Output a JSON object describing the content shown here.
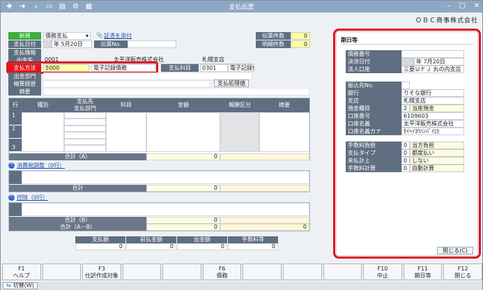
{
  "window": {
    "title": "支払伝票",
    "company": "ＯＢＣ商事株式会社"
  },
  "header": {
    "new_label": "新規",
    "slip_type": "債務支払",
    "evidence_link": "証憑を添付",
    "pay_date_label": "支払日付",
    "pay_date_value": "年  5月20日",
    "slip_no_label": "伝票No.",
    "pay_info_label": "支払情報",
    "payee_label": "出金先",
    "payee_code": "0001",
    "payee_name": "太平洋販売株式会社",
    "branch": "札幌支店",
    "method_label": "支払方法",
    "method_code": "5000",
    "method_name": "電子記録債務",
    "account_label": "支払科目",
    "account_code": "0301",
    "account_name": "電子記録債",
    "dept_label": "出金部門",
    "approval_label": "精算経歴",
    "process_button": "支払処理値",
    "memo_label": "摘要",
    "slip_count_label": "伝票件数",
    "slip_count_value": "0",
    "detail_count_label": "明細件数",
    "detail_count_value": "0"
  },
  "grid": {
    "headers": [
      "行",
      "種別",
      "支払先",
      "支払部門",
      "科目",
      "金額",
      "報酬区分",
      "摘要"
    ],
    "rows": [
      "1",
      "2",
      "3"
    ],
    "total_a_label": "合計（A）",
    "total_a_value": "0"
  },
  "tax_section": {
    "label": "消費税調整（0行）",
    "total_label": "合計",
    "total_value": "0"
  },
  "deduction_section": {
    "label": "控除（0行）",
    "total_b_label": "合計（B）",
    "total_b_value": "0",
    "total_ab_label": "合計（A－B）",
    "total_ab_value1": "0",
    "total_ab_value2": "0"
  },
  "summary": {
    "headers": [
      "支払額",
      "前払金額",
      "出金額",
      "手数料等"
    ],
    "values": [
      "0",
      "0",
      "0",
      "0"
    ]
  },
  "panel": {
    "title": "期日等",
    "rows1": [
      {
        "label": "債務番号",
        "value": ""
      },
      {
        "label": "決済日付",
        "value": "年  7月20日"
      },
      {
        "label": "法人口座",
        "value": "三菱ＵＦＪ  丸の内支店"
      }
    ],
    "rows2": [
      {
        "label": "振込先No.",
        "value": ""
      },
      {
        "label": "銀行",
        "value": "りそな銀行"
      },
      {
        "label": "支店",
        "value": "札幌支店"
      },
      {
        "label": "預金種目",
        "code": "2",
        "value": "当座預金"
      },
      {
        "label": "口座番号",
        "value": "6109603"
      },
      {
        "label": "口座名義",
        "value": "太平洋販売株式会社"
      },
      {
        "label": "口座名義カナ",
        "value": "ﾀｲﾍｲﾖｳﾊﾝﾊﾞｲ(ｶ"
      }
    ],
    "rows3": [
      {
        "label": "手数料負担",
        "code": "0",
        "value": "当方負担"
      },
      {
        "label": "支払タイプ",
        "code": "0",
        "value": "都度払い"
      },
      {
        "label": "未払計上",
        "code": "0",
        "value": "しない"
      },
      {
        "label": "手数料計算",
        "code": "0",
        "value": "自動計算"
      }
    ],
    "close_button": "閉じる(C)"
  },
  "fkeys": [
    {
      "key": "F1",
      "label": "ヘルプ"
    },
    {
      "key": "",
      "label": ""
    },
    {
      "key": "F3",
      "label": "仕訳作成対象"
    },
    {
      "key": "",
      "label": ""
    },
    {
      "key": "",
      "label": ""
    },
    {
      "key": "F6",
      "label": "債務"
    },
    {
      "key": "",
      "label": ""
    },
    {
      "key": "",
      "label": ""
    },
    {
      "key": "",
      "label": ""
    },
    {
      "key": "F10",
      "label": "中止"
    },
    {
      "key": "F11",
      "label": "期日等"
    },
    {
      "key": "F12",
      "label": "閉じる"
    }
  ],
  "status": {
    "switch_label": "切替(W)"
  }
}
